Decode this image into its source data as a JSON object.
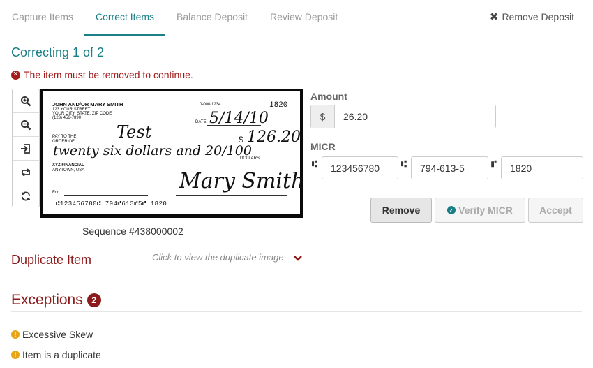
{
  "tabs": [
    {
      "label": "Capture Items"
    },
    {
      "label": "Correct Items"
    },
    {
      "label": "Balance Deposit"
    },
    {
      "label": "Review Deposit"
    }
  ],
  "remove_deposit_label": "Remove Deposit",
  "correcting_title": "Correcting 1 of 2",
  "error_message": "The item must be removed to continue.",
  "toolbar": [
    {
      "icon": "zoom-in-icon"
    },
    {
      "icon": "zoom-out-icon"
    },
    {
      "icon": "flip-icon"
    },
    {
      "icon": "rotate-icon"
    },
    {
      "icon": "reset-icon"
    }
  ],
  "check": {
    "name": "JOHN AND/OR MARY SMITH",
    "address1": "123 YOUR STREET",
    "address2": "YOUR CITY, STATE, ZIP CODE",
    "phone": "(123) 456-7890",
    "check_number": "1820",
    "routing_small": "0-000/1234",
    "date_label": "DATE",
    "date_value": "5/14/10",
    "pay_to_label": "PAY TO THE ORDER OF",
    "payee": "Test",
    "amount_symbol": "$",
    "amount_written": "126.20",
    "written_words": "twenty six dollars and 20/100",
    "dollars_label": "DOLLARS",
    "bank_name": "XYZ FINANCIAL",
    "bank_city": "ANYTOWN, USA",
    "for_label": "For",
    "signature": "Mary Smith",
    "micr_line": "⑆123456780⑆ 794⑈613⑈5⑈ 1820"
  },
  "sequence": "Sequence #438000002",
  "amount": {
    "label": "Amount",
    "prefix": "$",
    "value": "26.20"
  },
  "micr": {
    "label": "MICR",
    "routing": "123456780",
    "account": "794-613-5",
    "check_number": "1820"
  },
  "buttons": {
    "remove": "Remove",
    "verify": "Verify MICR",
    "accept": "Accept"
  },
  "duplicate": {
    "title": "Duplicate Item",
    "hint": "Click to view the duplicate image"
  },
  "exceptions": {
    "title": "Exceptions",
    "count": "2",
    "items": [
      {
        "label": "Excessive Skew"
      },
      {
        "label": "Item is a duplicate"
      }
    ]
  },
  "colors": {
    "accent": "#1b7f86",
    "error": "#a31b1b",
    "exception": "#8b1a1a",
    "warning": "#e8a317"
  }
}
